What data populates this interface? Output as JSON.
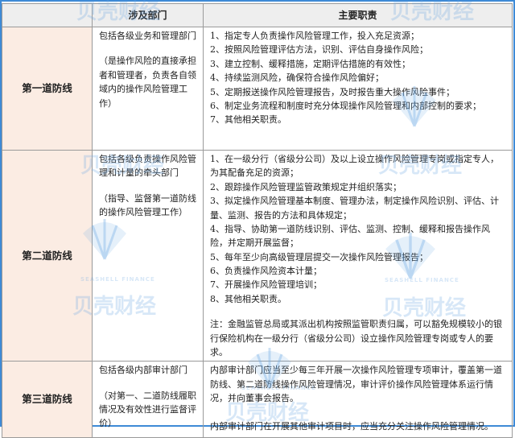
{
  "table": {
    "headers": [
      "",
      "涉及部门",
      "主要职责"
    ],
    "rows": [
      {
        "line": "第一道防线",
        "dept_main": "包括各级业务和管理部门",
        "dept_note": "（是操作风险的直接承担者和管理者，负责各自领域内的操作风险管理工作）",
        "duties": [
          "1、指定专人负责操作风险管理工作，投入充足资源；",
          "2、按照风险管理评估方法，识别、评估自身操作风险；",
          "3、建立控制、缓释措施，定期评估措施的有效性；",
          "4、持续监测风险，确保符合操作风险偏好；",
          "5、定期报送操作风险管理报告，及时报告重大操作风险事件；",
          "6、制定业务流程和制度时充分体现操作风险管理和内部控制的要求；",
          "7、其他相关职责。"
        ],
        "remark": ""
      },
      {
        "line": "第二道防线",
        "dept_main": "包括各级负责操作风险管理和计量的牵头部门",
        "dept_note": "（指导、监督第一道防线的操作风险管理工作）",
        "duties": [
          "1、在一级分行（省级分公司）及以上设立操作风险管理专岗或指定专人，为其配备充足的资源；",
          "2、跟踪操作风险管理监管政策规定并组织落实；",
          "3、拟定操作风险管理基本制度、管理办法，制定操作风险识别、评估、计量、监测、报告的方法和具体规定；",
          "4、指导、协助第一道防线识别、评估、监测、控制、缓释和报告操作风险，并定期开展监督；",
          "5、每年至少向高级管理层提交一次操作风险管理报告；",
          "6、负责操作风险资本计量；",
          "7、开展操作风险管理培训；",
          "8、其他相关职责。"
        ],
        "remark": "注：金融监管总局或其派出机构按照监管职责归属，可以豁免规模较小的银行保险机构在一级分行（省级分公司）设立操作风险管理专岗或专人的要求。"
      },
      {
        "line": "第三道防线",
        "dept_main": "包括各级内部审计部门",
        "dept_note": "（对第一、二道防线履职情况及有效性进行监督评价）",
        "duties": [
          "内部审计部门应当至少每三年开展一次操作风险管理专项审计，覆盖第一道防线、第二道防线操作风险管理情况，审计评价操作风险管理体系运行情况，并向董事会报告。",
          "内部审计部门在开展其他审计项目时，应当充分关注操作风险管理情况。"
        ],
        "remark": ""
      }
    ]
  },
  "watermarks": [
    "贝壳财经",
    "SEASHELL FINANCE"
  ]
}
